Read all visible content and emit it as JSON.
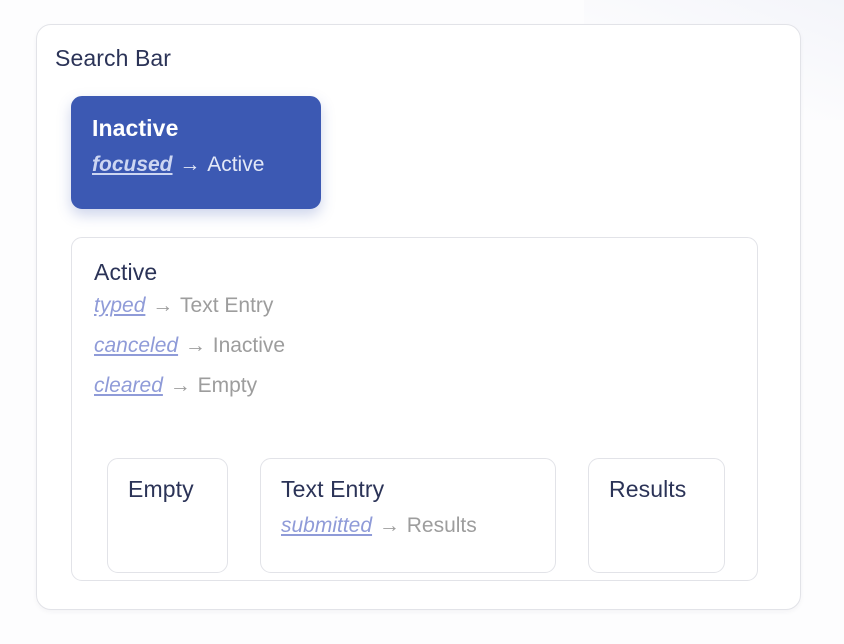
{
  "machine": {
    "title": "Search Bar"
  },
  "colors": {
    "accent": "#3c59b3",
    "title_text": "#2b3357",
    "event_text": "#8f9bd8",
    "target_text": "#9d9d9d",
    "border": "#e2e3e8",
    "page_background": "#fdfdfe"
  },
  "arrow_glyph": "→",
  "states": {
    "inactive": {
      "label": "Inactive",
      "highlighted": true,
      "transitions": [
        {
          "event": "focused",
          "target": "Active"
        }
      ]
    },
    "active": {
      "label": "Active",
      "transitions": [
        {
          "event": "typed",
          "target": "Text Entry"
        },
        {
          "event": "canceled",
          "target": "Inactive"
        },
        {
          "event": "cleared",
          "target": "Empty"
        }
      ],
      "children": [
        {
          "label": "Empty",
          "transitions": []
        },
        {
          "label": "Text Entry",
          "transitions": [
            {
              "event": "submitted",
              "target": "Results"
            }
          ]
        },
        {
          "label": "Results",
          "transitions": []
        }
      ]
    }
  }
}
